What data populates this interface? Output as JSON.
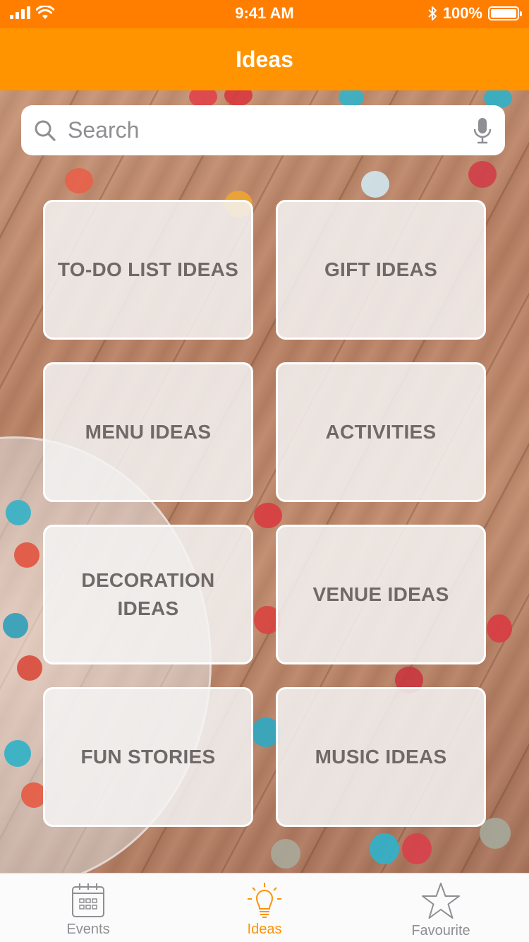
{
  "status_bar": {
    "time": "9:41 AM",
    "battery_percent": "100%",
    "battery_level": 1.0,
    "icons": [
      "signal-icon",
      "wifi-icon",
      "bluetooth-icon",
      "battery-icon"
    ]
  },
  "nav": {
    "title": "Ideas"
  },
  "search": {
    "placeholder": "Search",
    "value": ""
  },
  "tiles": [
    {
      "label": "TO-DO LIST IDEAS"
    },
    {
      "label": "GIFT IDEAS"
    },
    {
      "label": "MENU IDEAS"
    },
    {
      "label": "ACTIVITIES"
    },
    {
      "label": "DECORATION IDEAS"
    },
    {
      "label": "VENUE IDEAS"
    },
    {
      "label": "FUN STORIES"
    },
    {
      "label": "MUSIC IDEAS"
    }
  ],
  "tab_bar": {
    "items": [
      {
        "label": "Events",
        "icon": "calendar-icon",
        "active": false
      },
      {
        "label": "Ideas",
        "icon": "lightbulb-icon",
        "active": true
      },
      {
        "label": "Favourite",
        "icon": "star-icon",
        "active": false
      }
    ]
  },
  "colors": {
    "status_bar": "#ff7e00",
    "nav_bar": "#ff9300",
    "active_tab": "#ff9300",
    "inactive_tab": "#8e8e93",
    "tile_text": "#6f6a68"
  }
}
